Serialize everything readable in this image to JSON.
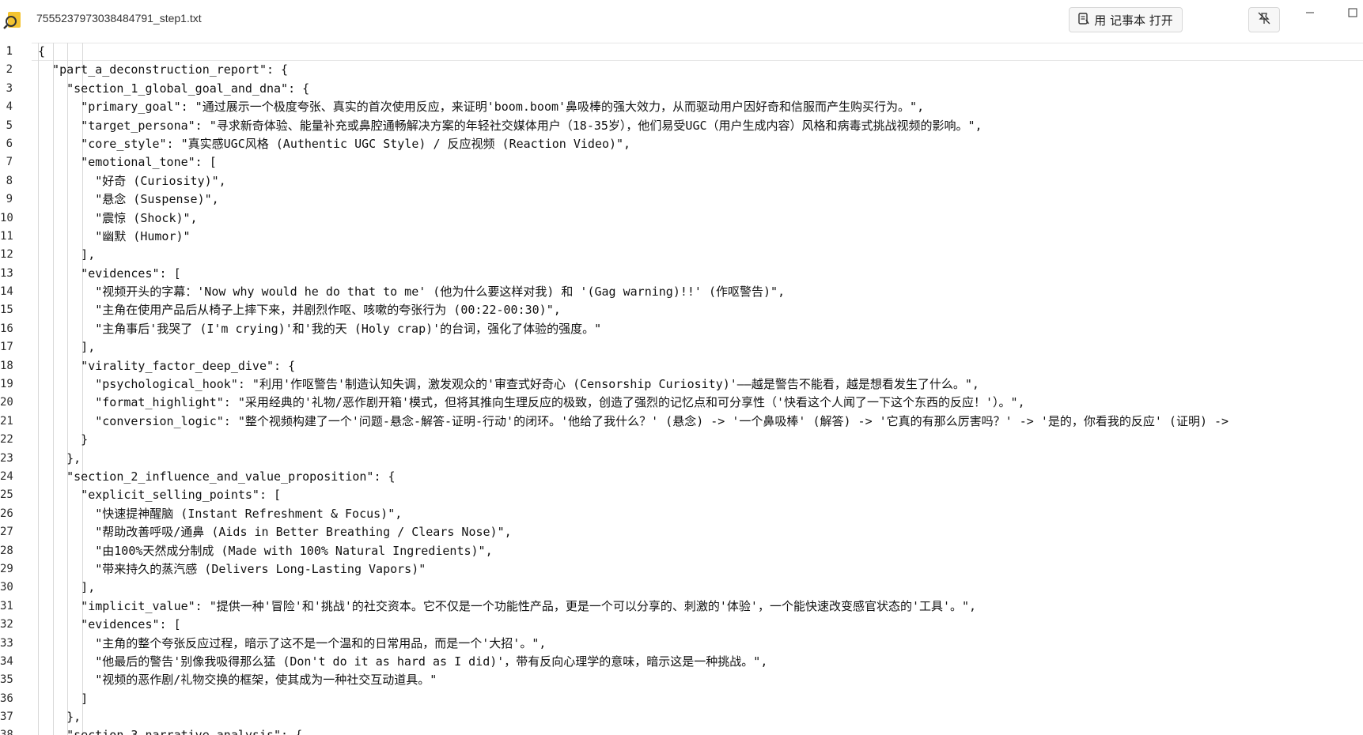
{
  "window": {
    "file_name": "7555237973038484791_step1.txt",
    "open_with_notepad_label": "用 记事本 打开",
    "icons": {
      "app": "magnifier-document-icon",
      "notepad": "notepad-icon",
      "pin": "unpin-icon",
      "minimize": "minimize-icon",
      "maximize": "maximize-icon"
    }
  },
  "editor": {
    "active_line": 1,
    "lines": [
      {
        "n": "1",
        "t": "{"
      },
      {
        "n": "2",
        "t": "  \"part_a_deconstruction_report\": {"
      },
      {
        "n": "3",
        "t": "    \"section_1_global_goal_and_dna\": {"
      },
      {
        "n": "4",
        "t": "      \"primary_goal\": \"通过展示一个极度夸张、真实的首次使用反应，来证明'boom.boom'鼻吸棒的强大效力，从而驱动用户因好奇和信服而产生购买行为。\","
      },
      {
        "n": "5",
        "t": "      \"target_persona\": \"寻求新奇体验、能量补充或鼻腔通畅解决方案的年轻社交媒体用户（18-35岁），他们易受UGC（用户生成内容）风格和病毒式挑战视频的影响。\","
      },
      {
        "n": "6",
        "t": "      \"core_style\": \"真实感UGC风格 (Authentic UGC Style) / 反应视频 (Reaction Video)\","
      },
      {
        "n": "7",
        "t": "      \"emotional_tone\": ["
      },
      {
        "n": "8",
        "t": "        \"好奇 (Curiosity)\","
      },
      {
        "n": "9",
        "t": "        \"悬念 (Suspense)\","
      },
      {
        "n": "10",
        "t": "        \"震惊 (Shock)\","
      },
      {
        "n": "11",
        "t": "        \"幽默 (Humor)\""
      },
      {
        "n": "12",
        "t": "      ],"
      },
      {
        "n": "13",
        "t": "      \"evidences\": ["
      },
      {
        "n": "14",
        "t": "        \"视频开头的字幕：'Now why would he do that to me' (他为什么要这样对我) 和 '(Gag warning)!!' (作呕警告)\","
      },
      {
        "n": "15",
        "t": "        \"主角在使用产品后从椅子上摔下来，并剧烈作呕、咳嗽的夸张行为 (00:22-00:30)\","
      },
      {
        "n": "16",
        "t": "        \"主角事后'我哭了 (I'm crying)'和'我的天 (Holy crap)'的台词，强化了体验的强度。\""
      },
      {
        "n": "17",
        "t": "      ],"
      },
      {
        "n": "18",
        "t": "      \"virality_factor_deep_dive\": {"
      },
      {
        "n": "19",
        "t": "        \"psychological_hook\": \"利用'作呕警告'制造认知失调，激发观众的'审查式好奇心 (Censorship Curiosity)'——越是警告不能看，越是想看发生了什么。\","
      },
      {
        "n": "20",
        "t": "        \"format_highlight\": \"采用经典的'礼物/恶作剧开箱'模式，但将其推向生理反应的极致，创造了强烈的记忆点和可分享性（'快看这个人闻了一下这个东西的反应！'）。\","
      },
      {
        "n": "21",
        "t": "        \"conversion_logic\": \"整个视频构建了一个'问题-悬念-解答-证明-行动'的闭环。'他给了我什么？' (悬念) -> '一个鼻吸棒' (解答) -> '它真的有那么厉害吗？' -> '是的，你看我的反应' (证明) ->"
      },
      {
        "n": "22",
        "t": "      }"
      },
      {
        "n": "23",
        "t": "    },"
      },
      {
        "n": "24",
        "t": "    \"section_2_influence_and_value_proposition\": {"
      },
      {
        "n": "25",
        "t": "      \"explicit_selling_points\": ["
      },
      {
        "n": "26",
        "t": "        \"快速提神醒脑 (Instant Refreshment & Focus)\","
      },
      {
        "n": "27",
        "t": "        \"帮助改善呼吸/通鼻 (Aids in Better Breathing / Clears Nose)\","
      },
      {
        "n": "28",
        "t": "        \"由100%天然成分制成 (Made with 100% Natural Ingredients)\","
      },
      {
        "n": "29",
        "t": "        \"带来持久的蒸汽感 (Delivers Long-Lasting Vapors)\""
      },
      {
        "n": "30",
        "t": "      ],"
      },
      {
        "n": "31",
        "t": "      \"implicit_value\": \"提供一种'冒险'和'挑战'的社交资本。它不仅是一个功能性产品，更是一个可以分享的、刺激的'体验'，一个能快速改变感官状态的'工具'。\","
      },
      {
        "n": "32",
        "t": "      \"evidences\": ["
      },
      {
        "n": "33",
        "t": "        \"主角的整个夸张反应过程，暗示了这不是一个温和的日常用品，而是一个'大招'。\","
      },
      {
        "n": "34",
        "t": "        \"他最后的警告'别像我吸得那么猛 (Don't do it as hard as I did)'，带有反向心理学的意味，暗示这是一种挑战。\","
      },
      {
        "n": "35",
        "t": "        \"视频的恶作剧/礼物交换的框架，使其成为一种社交互动道具。\""
      },
      {
        "n": "36",
        "t": "      ]"
      },
      {
        "n": "37",
        "t": "    },"
      },
      {
        "n": "38",
        "t": "    \"section_3_narrative_analysis\": {"
      }
    ]
  }
}
